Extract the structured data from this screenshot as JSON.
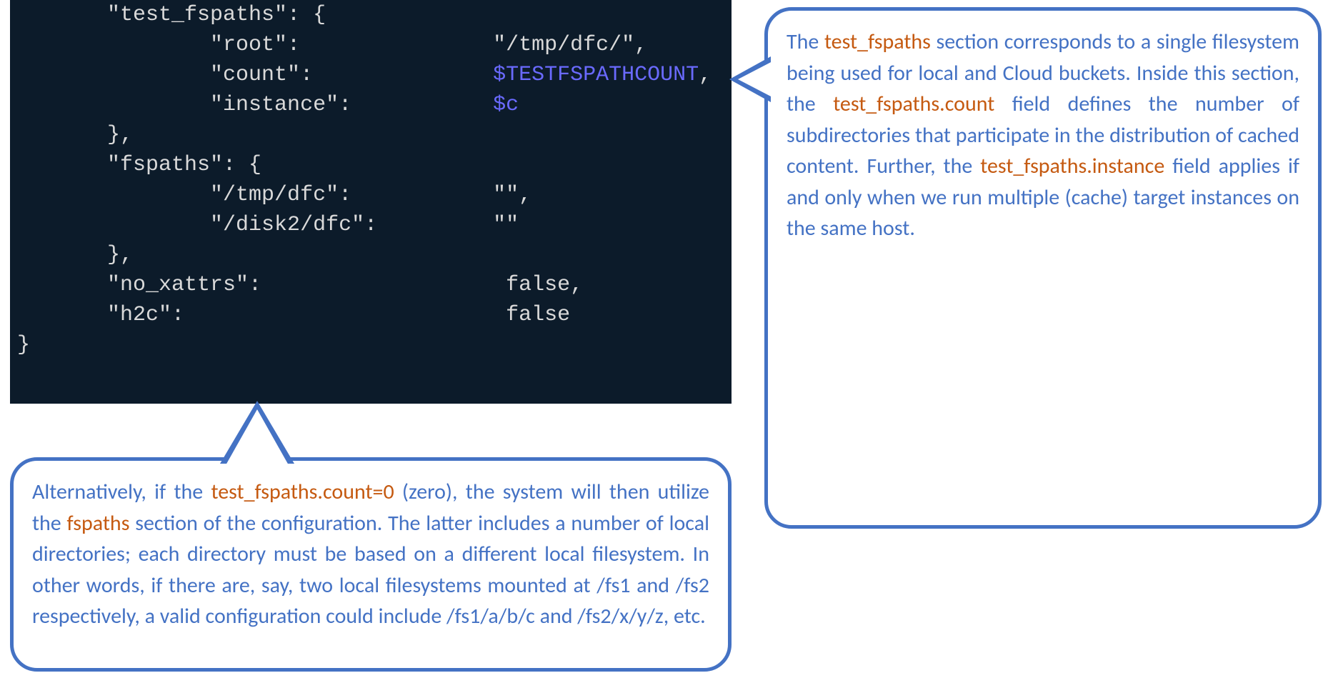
{
  "code": {
    "l1": "       \"test_fspaths\": {",
    "l2k": "               \"root\":",
    "l2v": "\"/tmp/dfc/\",",
    "l3k": "               \"count\":",
    "l3v": "$TESTFSPATHCOUNT",
    "l3c": ",",
    "l4k": "               \"instance\":",
    "l4v": "$c",
    "l5": "       },",
    "l6": "       \"fspaths\": {",
    "l7k": "               \"/tmp/dfc\":",
    "l7v": "\"\",",
    "l8k": "               \"/disk2/dfc\":",
    "l8v": "\"\"",
    "l9": "       },",
    "l10k": "       \"no_xattrs\":",
    "l10v": "false,",
    "l11k": "       \"h2c\":",
    "l11v": "false",
    "l12": "}"
  },
  "right": {
    "p1a": "The ",
    "h1": "test_fspaths",
    "p1b": " section corresponds to a single filesystem being used for local and Cloud buckets. Inside this section, the ",
    "h2": "test_fspaths.count",
    "p1c": " field defines the number of subdirectories that participate in the distribution of cached content. Further, the ",
    "h3": "test_fspaths.instance",
    "p1d": " field applies if and only when we run multiple (cache) target instances on the same host."
  },
  "bottom": {
    "p1a": "Alternatively, if the ",
    "h1": "test_fspaths.count=0",
    "p1b": " (zero), the system will then utilize the ",
    "h2": "fspaths",
    "p1c": " section of the configuration. The latter includes a number of local directories; each directory must be based on a different local filesystem. In other words, if there are, say, two local filesystems mounted at /fs1 and /fs2 respectively, a valid configuration could include /fs1/a/b/c and /fs2/x/y/z, etc."
  }
}
